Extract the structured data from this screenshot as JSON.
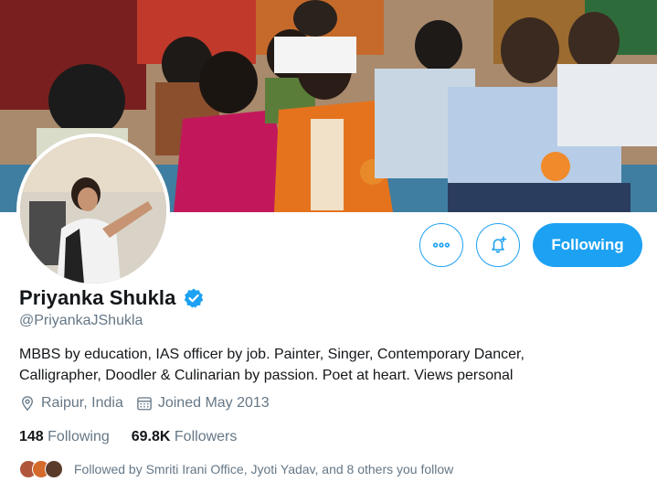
{
  "profile": {
    "name": "Priyanka Shukla",
    "handle": "@PriyankaJShukla",
    "bio_line1": "MBBS by education, IAS officer by job. Painter, Singer, Contemporary Dancer,",
    "bio_line2": "Calligrapher, Doodler & Culinarian by passion. Poet at heart. Views personal",
    "location": "Raipur, India",
    "joined": "Joined May 2013",
    "verified": true
  },
  "stats": {
    "following_count": "148",
    "following_label": "Following",
    "followers_count": "69.8K",
    "followers_label": "Followers"
  },
  "actions": {
    "more_icon": "more-dots-icon",
    "notify_icon": "bell-plus-icon",
    "following_button": "Following"
  },
  "followed_by": {
    "text": "Followed by Smriti Irani Office, Jyoti Yadav, and 8 others you follow"
  },
  "colors": {
    "accent": "#1da1f2",
    "text_primary": "#14171a",
    "text_secondary": "#657786"
  }
}
